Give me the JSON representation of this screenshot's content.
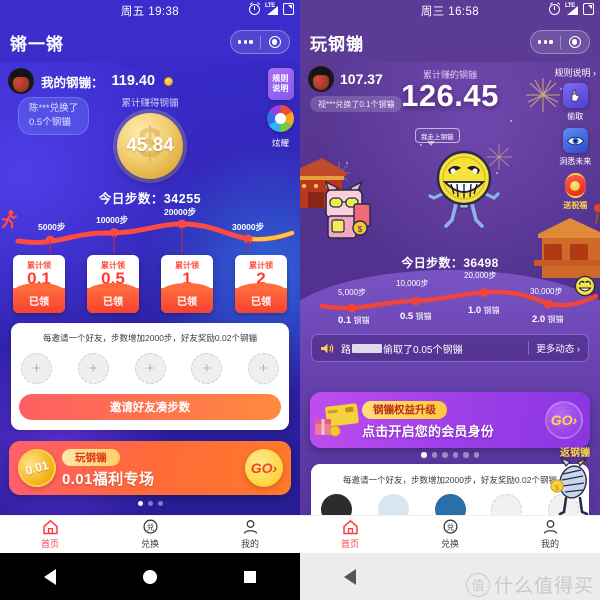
{
  "left": {
    "status": {
      "day_time": "周五 19:38",
      "icons": [
        "alarm-icon",
        "lte-signal-icon",
        "battery-icon"
      ]
    },
    "titlebar": {
      "title": "锵一锵",
      "capsule_more": "more-dots-icon",
      "capsule_target": "target-icon"
    },
    "account": {
      "label": "我的钢镚：",
      "value": "119.40",
      "coin_icon": "coin-icon"
    },
    "toast": "陈***兑换了\n0.5个钢镚",
    "side_icons": [
      {
        "name": "rule-badge",
        "label": "规则\n说明"
      },
      {
        "name": "aperture-icon",
        "label": "炫耀"
      }
    ],
    "earn_label": "累计赚得钢镚",
    "earn_value": "45.84",
    "today_steps": "今日步数：34255",
    "track": {
      "milestones": [
        "5000步",
        "10000步",
        "20000步",
        "30000步"
      ],
      "runner_icon": "running-person-icon"
    },
    "cards": [
      {
        "title": "累计领",
        "value": "0.1",
        "status": "已领"
      },
      {
        "title": "累计领",
        "value": "0.5",
        "status": "已领"
      },
      {
        "title": "累计领",
        "value": "1",
        "status": "已领"
      },
      {
        "title": "累计领",
        "value": "2",
        "status": "已领"
      }
    ],
    "panel": {
      "tip": "每邀请一个好友，步数增加2000步，好友奖励0.02个钢镚",
      "slot_icon": "+",
      "slots": 5,
      "invite_button": "邀请好友凑步数"
    },
    "banner": {
      "coin_value": "0.01",
      "tag": "玩钢镚",
      "main": "0.01福利专场",
      "go": "GO",
      "dots": 3,
      "active_dot": 0
    },
    "tabs": [
      {
        "label": "首页",
        "icon": "home-icon",
        "active": true
      },
      {
        "label": "兑换",
        "icon": "exchange-icon",
        "active": false
      },
      {
        "label": "我的",
        "icon": "person-icon",
        "active": false
      }
    ],
    "navbar": [
      "back-triangle-icon",
      "home-circle-icon",
      "recents-square-icon"
    ]
  },
  "right": {
    "status": {
      "day_time": "周三 16:58",
      "icons": [
        "alarm-icon",
        "lte-signal-icon",
        "battery-icon"
      ]
    },
    "titlebar": {
      "title": "玩钢镚",
      "capsule_more": "more-dots-icon",
      "capsule_target": "target-icon"
    },
    "account": {
      "value": "107.37"
    },
    "toast": "视***兑换了0.1个钢镚",
    "earn_label": "累计赚的钢镚",
    "earn_value": "126.45",
    "side_icons": [
      {
        "name": "rule-link",
        "label": "规则说明"
      },
      {
        "name": "hand-icon",
        "label": "偷取"
      },
      {
        "name": "eye-icon",
        "label": "洞悉未来"
      },
      {
        "name": "lantern-icon",
        "label": "送祝福"
      }
    ],
    "speech_bubble": "我走上钢镚",
    "today_steps": "今日步数：36498",
    "track": {
      "milestones_top": [
        "5,000步",
        "10,000步",
        "20,000步",
        "30,000步"
      ],
      "milestones_bottom": [
        {
          "num": "0.1",
          "unit": "钢镚"
        },
        {
          "num": "0.5",
          "unit": "钢镚"
        },
        {
          "num": "1.0",
          "unit": "钢镚"
        },
        {
          "num": "2.0",
          "unit": "钢镚"
        }
      ],
      "face_icon": "smiley-face-icon"
    },
    "newsbar": {
      "speaker_icon": "speaker-icon",
      "prefix": "路",
      "suffix": "偷取了0.05个钢镚",
      "more": "更多动态 ›"
    },
    "banner": {
      "gift_icon": "gift-card-icon",
      "tag": "钢镚权益升级",
      "main": "点击开启您的会员身份",
      "go": "GO",
      "back_label": "返钢镚",
      "dots": 6,
      "active_dot": 0
    },
    "panel": {
      "tip": "每邀请一个好友，步数增加2000步，好友奖励0.02个钢镚"
    },
    "tabs": [
      {
        "label": "首页",
        "icon": "home-icon",
        "active": true
      },
      {
        "label": "兑换",
        "icon": "exchange-icon",
        "active": false
      },
      {
        "label": "我的",
        "icon": "person-icon",
        "active": false
      }
    ],
    "navbar": [
      "back-triangle-icon"
    ]
  },
  "watermark": {
    "logo": "值",
    "text": "什么值得买"
  },
  "colors": {
    "left_bg": "#3326b8",
    "right_bg": "#4e2f8c",
    "accent_red": "#ff3b2f",
    "accent_gold": "#ffd24a",
    "tab_active": "#fa3e3e"
  }
}
